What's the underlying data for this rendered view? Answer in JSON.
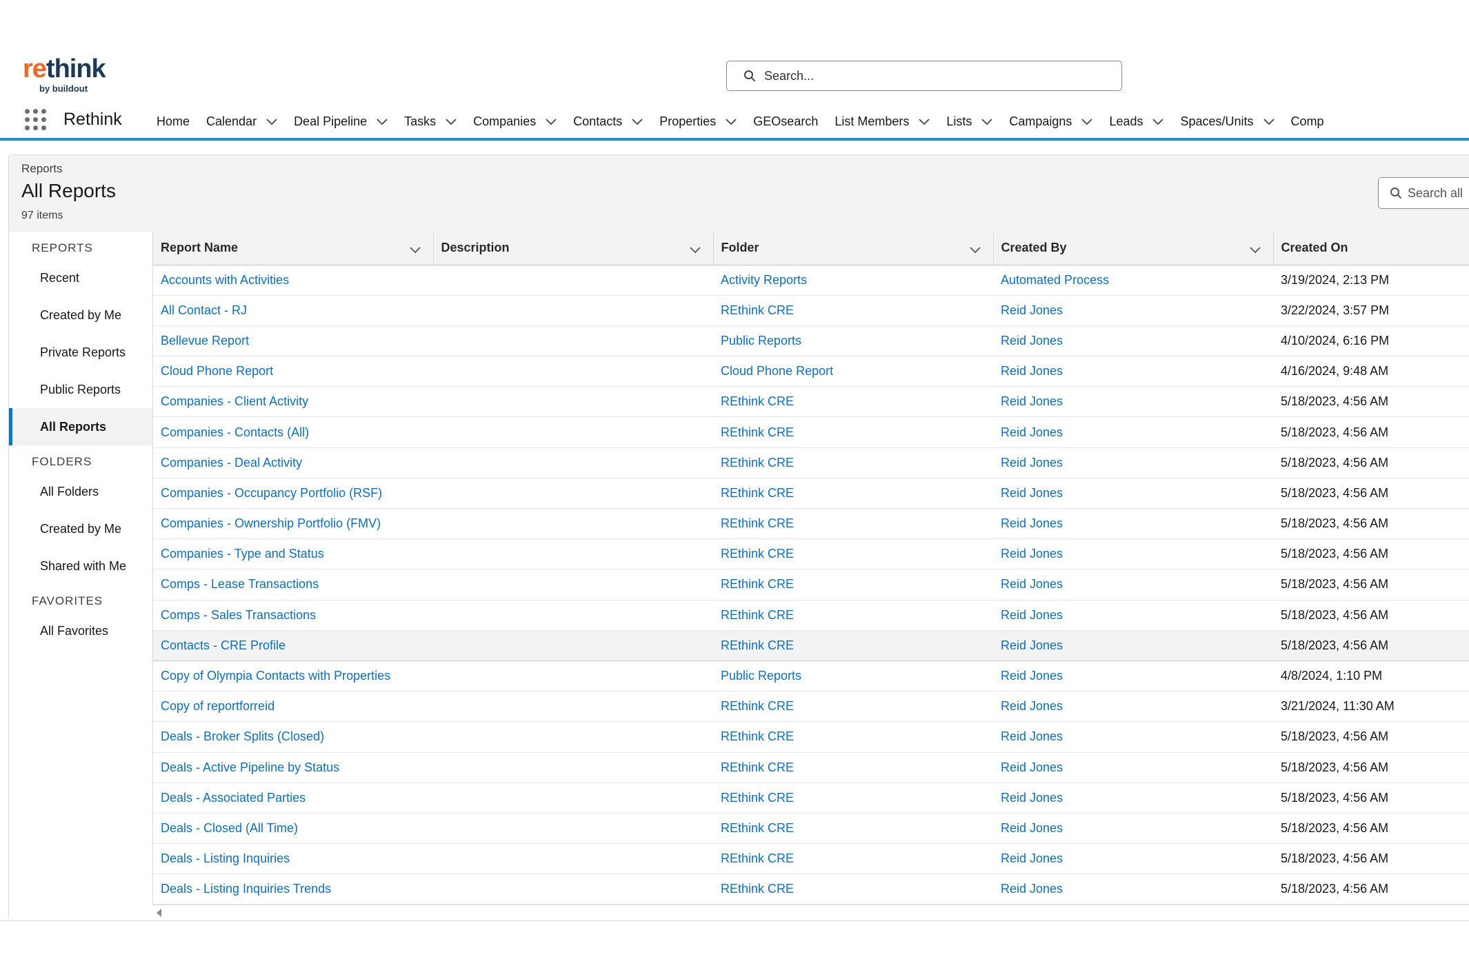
{
  "logo": {
    "brand_re": "re",
    "brand_think": "think",
    "sub": "by buildout"
  },
  "search": {
    "placeholder": "Search..."
  },
  "nav": {
    "app_name": "Rethink",
    "items": [
      {
        "label": "Home",
        "dropdown": false
      },
      {
        "label": "Calendar",
        "dropdown": true
      },
      {
        "label": "Deal Pipeline",
        "dropdown": true
      },
      {
        "label": "Tasks",
        "dropdown": true
      },
      {
        "label": "Companies",
        "dropdown": true
      },
      {
        "label": "Contacts",
        "dropdown": true
      },
      {
        "label": "Properties",
        "dropdown": true
      },
      {
        "label": "GEOsearch",
        "dropdown": false
      },
      {
        "label": "List Members",
        "dropdown": true
      },
      {
        "label": "Lists",
        "dropdown": true
      },
      {
        "label": "Campaigns",
        "dropdown": true
      },
      {
        "label": "Leads",
        "dropdown": true
      },
      {
        "label": "Spaces/Units",
        "dropdown": true
      },
      {
        "label": "Comp",
        "dropdown": false
      }
    ]
  },
  "page_header": {
    "breadcrumb": "Reports",
    "title": "All Reports",
    "count": "97 items",
    "search_placeholder": "Search all"
  },
  "sidebar": {
    "sections": [
      {
        "title": "REPORTS",
        "items": [
          "Recent",
          "Created by Me",
          "Private Reports",
          "Public Reports",
          "All Reports"
        ]
      },
      {
        "title": "FOLDERS",
        "items": [
          "All Folders",
          "Created by Me",
          "Shared with Me"
        ]
      },
      {
        "title": "FAVORITES",
        "items": [
          "All Favorites"
        ]
      }
    ],
    "active": "All Reports"
  },
  "table": {
    "columns": [
      "Report Name",
      "Description",
      "Folder",
      "Created By",
      "Created On"
    ],
    "rows": [
      {
        "name": "Accounts with Activities",
        "description": "",
        "folder": "Activity Reports",
        "created_by": "Automated Process",
        "created_on": "3/19/2024, 2:13 PM"
      },
      {
        "name": "All Contact - RJ",
        "description": "",
        "folder": "REthink CRE",
        "created_by": "Reid Jones",
        "created_on": "3/22/2024, 3:57 PM"
      },
      {
        "name": "Bellevue Report",
        "description": "",
        "folder": "Public Reports",
        "created_by": "Reid Jones",
        "created_on": "4/10/2024, 6:16 PM"
      },
      {
        "name": "Cloud Phone Report",
        "description": "",
        "folder": "Cloud Phone Report",
        "created_by": "Reid Jones",
        "created_on": "4/16/2024, 9:48 AM"
      },
      {
        "name": "Companies - Client Activity",
        "description": "",
        "folder": "REthink CRE",
        "created_by": "Reid Jones",
        "created_on": "5/18/2023, 4:56 AM"
      },
      {
        "name": "Companies - Contacts (All)",
        "description": "",
        "folder": "REthink CRE",
        "created_by": "Reid Jones",
        "created_on": "5/18/2023, 4:56 AM"
      },
      {
        "name": "Companies - Deal Activity",
        "description": "",
        "folder": "REthink CRE",
        "created_by": "Reid Jones",
        "created_on": "5/18/2023, 4:56 AM"
      },
      {
        "name": "Companies - Occupancy Portfolio (RSF)",
        "description": "",
        "folder": "REthink CRE",
        "created_by": "Reid Jones",
        "created_on": "5/18/2023, 4:56 AM"
      },
      {
        "name": "Companies - Ownership Portfolio (FMV)",
        "description": "",
        "folder": "REthink CRE",
        "created_by": "Reid Jones",
        "created_on": "5/18/2023, 4:56 AM"
      },
      {
        "name": "Companies - Type and Status",
        "description": "",
        "folder": "REthink CRE",
        "created_by": "Reid Jones",
        "created_on": "5/18/2023, 4:56 AM"
      },
      {
        "name": "Comps - Lease Transactions",
        "description": "",
        "folder": "REthink CRE",
        "created_by": "Reid Jones",
        "created_on": "5/18/2023, 4:56 AM"
      },
      {
        "name": "Comps - Sales Transactions",
        "description": "",
        "folder": "REthink CRE",
        "created_by": "Reid Jones",
        "created_on": "5/18/2023, 4:56 AM"
      },
      {
        "name": "Contacts - CRE Profile",
        "description": "",
        "folder": "REthink CRE",
        "created_by": "Reid Jones",
        "created_on": "5/18/2023, 4:56 AM",
        "highlighted": true
      },
      {
        "name": "Copy of Olympia Contacts with Properties",
        "description": "",
        "folder": "Public Reports",
        "created_by": "Reid Jones",
        "created_on": "4/8/2024, 1:10 PM"
      },
      {
        "name": "Copy of reportforreid",
        "description": "",
        "folder": "REthink CRE",
        "created_by": "Reid Jones",
        "created_on": "3/21/2024, 11:30 AM"
      },
      {
        "name": "Deals - Broker Splits (Closed)",
        "description": "",
        "folder": "REthink CRE",
        "created_by": "Reid Jones",
        "created_on": "5/18/2023, 4:56 AM"
      },
      {
        "name": "Deals - Active Pipeline by Status",
        "description": "",
        "folder": "REthink CRE",
        "created_by": "Reid Jones",
        "created_on": "5/18/2023, 4:56 AM"
      },
      {
        "name": "Deals - Associated Parties",
        "description": "",
        "folder": "REthink CRE",
        "created_by": "Reid Jones",
        "created_on": "5/18/2023, 4:56 AM"
      },
      {
        "name": "Deals - Closed (All Time)",
        "description": "",
        "folder": "REthink CRE",
        "created_by": "Reid Jones",
        "created_on": "5/18/2023, 4:56 AM"
      },
      {
        "name": "Deals - Listing Inquiries",
        "description": "",
        "folder": "REthink CRE",
        "created_by": "Reid Jones",
        "created_on": "5/18/2023, 4:56 AM"
      },
      {
        "name": "Deals - Listing Inquiries Trends",
        "description": "",
        "folder": "REthink CRE",
        "created_by": "Reid Jones",
        "created_on": "5/18/2023, 4:56 AM"
      }
    ]
  },
  "colors": {
    "accent": "#1b96d2",
    "link": "#0b6fc7",
    "brand_orange": "#f26522",
    "brand_navy": "#1b3a57"
  },
  "icons": {
    "search": "search-icon",
    "app_launcher": "waffle-icon",
    "dropdown": "chevron-down-icon"
  }
}
